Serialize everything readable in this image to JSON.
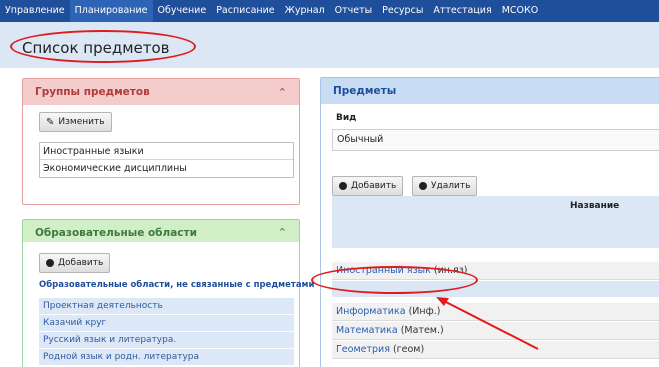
{
  "nav": {
    "items": [
      {
        "label": "Управление",
        "active": false
      },
      {
        "label": "Планирование",
        "active": true
      },
      {
        "label": "Обучение",
        "active": false
      },
      {
        "label": "Расписание",
        "active": false
      },
      {
        "label": "Журнал",
        "active": false
      },
      {
        "label": "Отчеты",
        "active": false
      },
      {
        "label": "Ресурсы",
        "active": false
      },
      {
        "label": "Аттестация",
        "active": false
      },
      {
        "label": "МСОКО",
        "active": false
      }
    ]
  },
  "page": {
    "title": "Список предметов"
  },
  "groups": {
    "title": "Группы предметов",
    "collapse_icon": "chevron-up-icon",
    "edit_label": "Изменить",
    "items": [
      "Иностранные языки",
      "Экономические дисциплины"
    ]
  },
  "areas": {
    "title": "Образовательные области",
    "collapse_icon": "chevron-up-icon",
    "add_label": "Добавить",
    "note": "Образовательные области, не связанные с предметами",
    "items": [
      "Проектная деятельность",
      "Казачий круг",
      "Русский язык и литература.",
      "Родной язык и родн. литература"
    ]
  },
  "subjects": {
    "title": "Предметы",
    "view_label": "Вид",
    "view_value": "Обычный",
    "add_label": "Добавить",
    "delete_label": "Удалить",
    "column_name": "Название",
    "rows": [
      {
        "name": "Иностранный язык",
        "abbr": "(ин.яз)",
        "highlighted": true
      },
      {
        "name": "Информатика",
        "abbr": "(Инф.)"
      },
      {
        "name": "Математика",
        "abbr": "(Матем.)"
      },
      {
        "name": "Геометрия",
        "abbr": "(геом)"
      }
    ]
  },
  "colors": {
    "nav_bg": "#1f4f9a",
    "accent": "#2a5db0",
    "annotation": "#e01b1b"
  }
}
